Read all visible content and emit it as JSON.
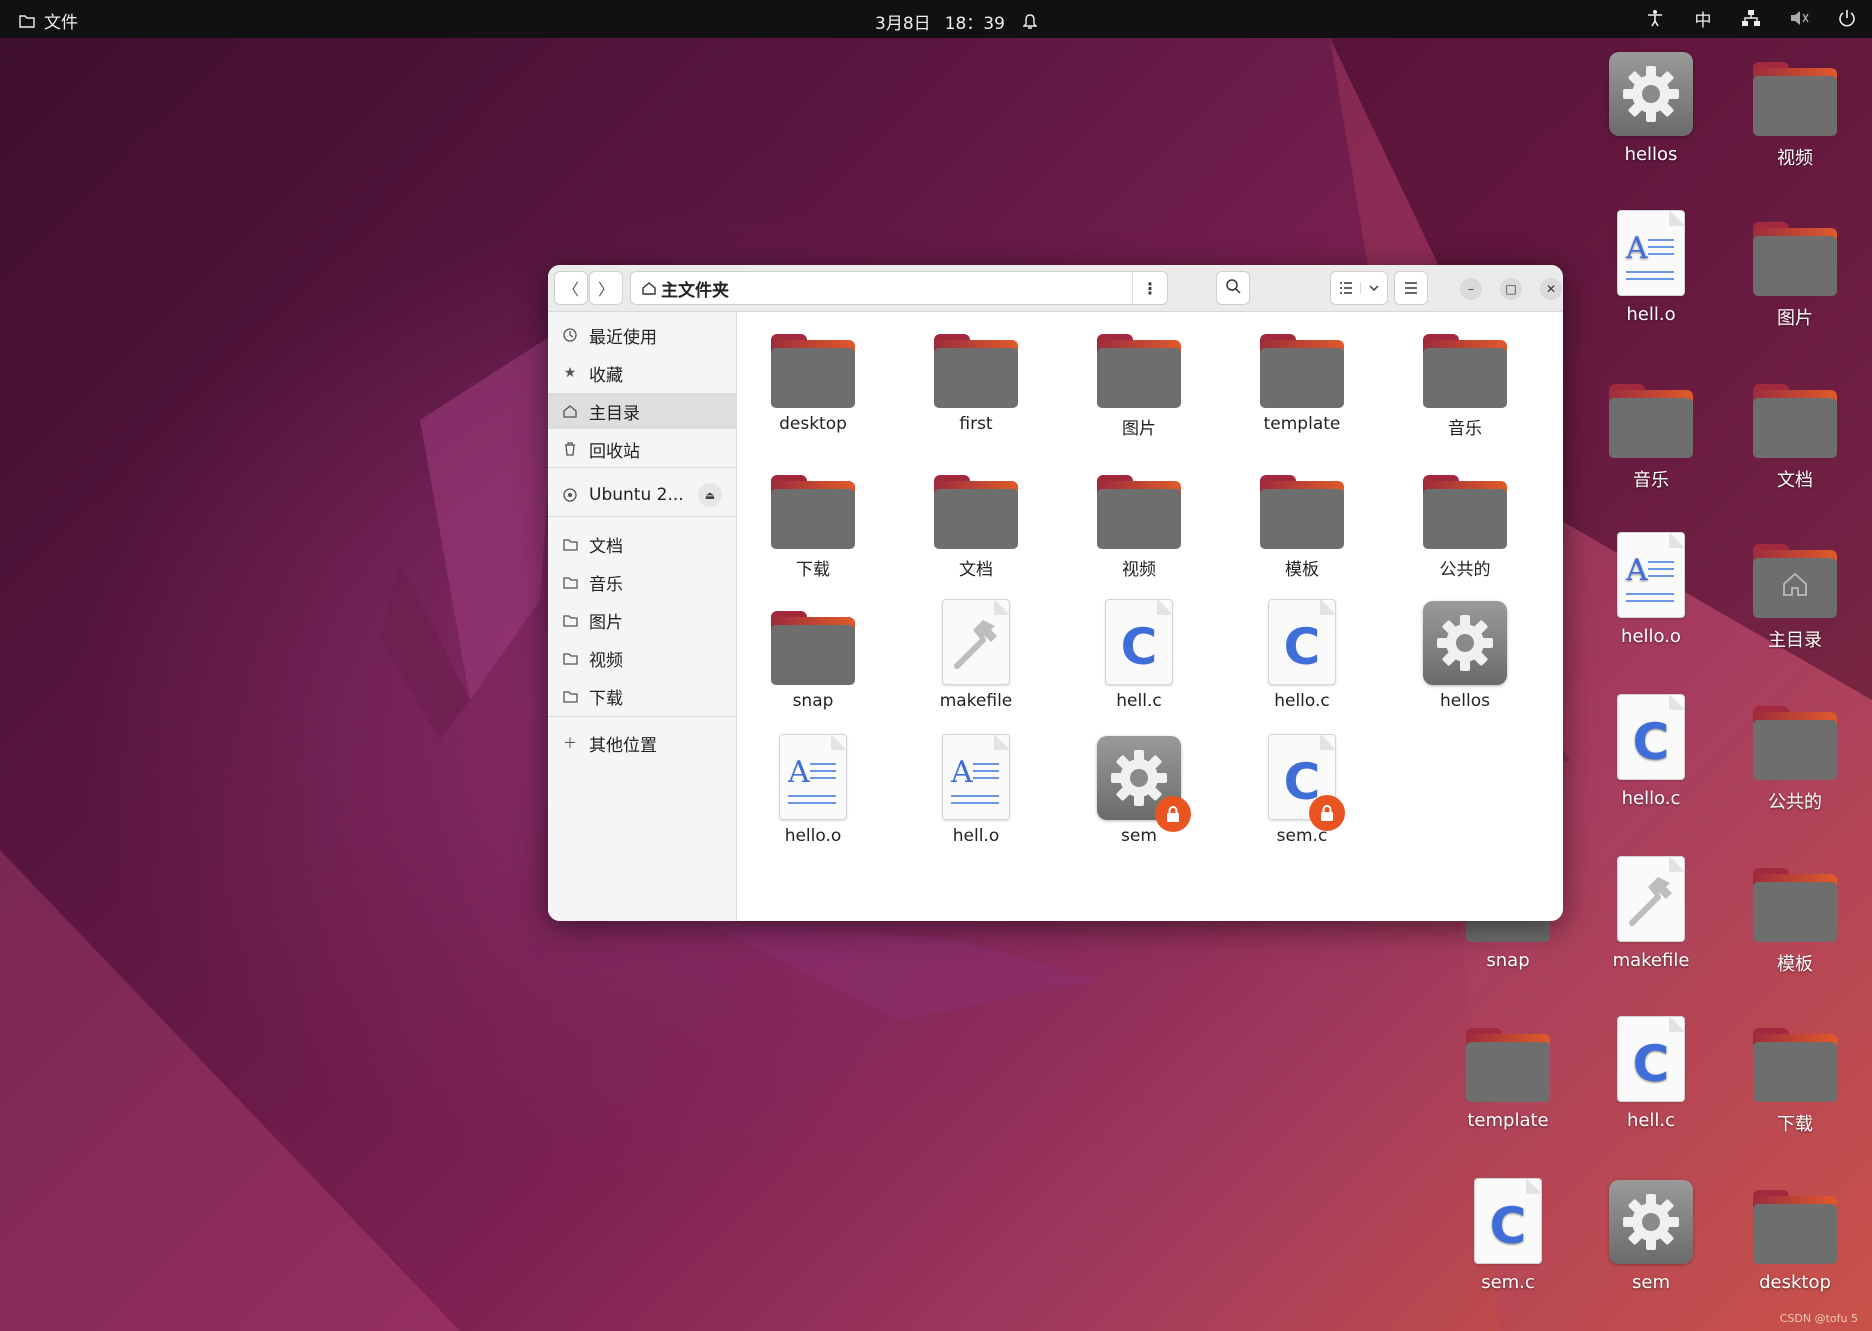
{
  "topbar": {
    "app_menu": "文件",
    "date": "3月8日",
    "time": "18：39",
    "input_method": "中"
  },
  "desktop": {
    "items": [
      {
        "label": "hellos",
        "type": "exec"
      },
      {
        "label": "视频",
        "type": "folder"
      },
      {
        "label": "hell.o",
        "type": "text"
      },
      {
        "label": "图片",
        "type": "folder"
      },
      {
        "label": "音乐",
        "type": "folder"
      },
      {
        "label": "文档",
        "type": "folder"
      },
      {
        "label": "hello.o",
        "type": "text"
      },
      {
        "label": "主目录",
        "type": "home"
      },
      {
        "label": "hello.c",
        "type": "c"
      },
      {
        "label": "公共的",
        "type": "folder"
      },
      {
        "label": "snap",
        "type": "folder"
      },
      {
        "label": "makefile",
        "type": "make"
      },
      {
        "label": "模板",
        "type": "folder"
      },
      {
        "label": "template",
        "type": "folder"
      },
      {
        "label": "hell.c",
        "type": "c"
      },
      {
        "label": "下载",
        "type": "folder"
      },
      {
        "label": "sem.c",
        "type": "c"
      },
      {
        "label": "sem",
        "type": "exec"
      },
      {
        "label": "desktop",
        "type": "folder"
      }
    ]
  },
  "window": {
    "title": "主文件夹",
    "sidebar": {
      "items": [
        {
          "label": "最近使用",
          "icon": "clock-icon"
        },
        {
          "label": "收藏",
          "icon": "star-icon"
        },
        {
          "label": "主目录",
          "icon": "home-icon"
        },
        {
          "label": "回收站",
          "icon": "trash-icon"
        },
        {
          "label": "Ubuntu 2...",
          "icon": "disc-icon"
        },
        {
          "label": "文档",
          "icon": "folder-icon"
        },
        {
          "label": "音乐",
          "icon": "folder-icon"
        },
        {
          "label": "图片",
          "icon": "folder-icon"
        },
        {
          "label": "视频",
          "icon": "folder-icon"
        },
        {
          "label": "下载",
          "icon": "folder-icon"
        },
        {
          "label": "其他位置",
          "icon": "plus-icon"
        }
      ]
    },
    "files": [
      {
        "label": "desktop",
        "type": "folder"
      },
      {
        "label": "first",
        "type": "folder"
      },
      {
        "label": "图片",
        "type": "folder"
      },
      {
        "label": "template",
        "type": "folder"
      },
      {
        "label": "音乐",
        "type": "folder"
      },
      {
        "label": "下载",
        "type": "folder"
      },
      {
        "label": "文档",
        "type": "folder"
      },
      {
        "label": "视频",
        "type": "folder"
      },
      {
        "label": "模板",
        "type": "folder"
      },
      {
        "label": "公共的",
        "type": "folder"
      },
      {
        "label": "snap",
        "type": "folder"
      },
      {
        "label": "makefile",
        "type": "make"
      },
      {
        "label": "hell.c",
        "type": "c"
      },
      {
        "label": "hello.c",
        "type": "c"
      },
      {
        "label": "hellos",
        "type": "exec"
      },
      {
        "label": "hello.o",
        "type": "text"
      },
      {
        "label": "hell.o",
        "type": "text"
      },
      {
        "label": "sem",
        "type": "exec-locked"
      },
      {
        "label": "sem.c",
        "type": "c-locked"
      }
    ]
  },
  "watermark": "CSDN @tofu 5",
  "colors": {
    "accent": "#e95420",
    "folder_front": "#6e6e6e",
    "c_glyph": "#3f6ed8"
  }
}
